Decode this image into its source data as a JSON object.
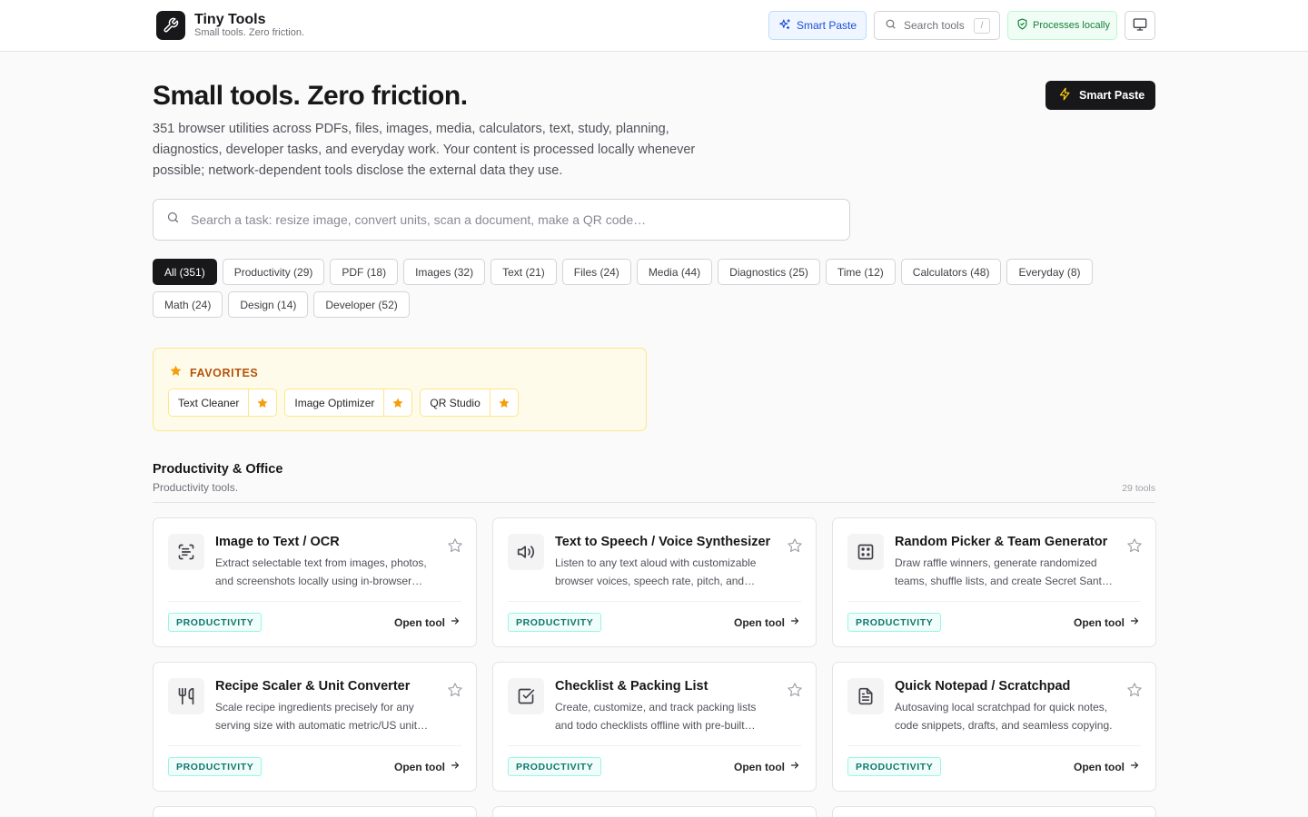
{
  "header": {
    "brand_title": "Tiny Tools",
    "brand_subtitle": "Small tools. Zero friction.",
    "smart_paste_label": "Smart Paste",
    "search_label": "Search tools",
    "search_shortcut": "/",
    "local_badge": "Processes locally"
  },
  "hero": {
    "title": "Small tools. Zero friction.",
    "description": "351 browser utilities across PDFs, files, images, media, calculators, text, study, planning, diagnostics, developer tasks, and everyday work. Your content is processed locally whenever possible; network-dependent tools disclose the external data they use.",
    "smart_paste_label": "Smart Paste",
    "search_placeholder": "Search a task: resize image, convert units, scan a document, make a QR code…"
  },
  "categories": [
    {
      "label": "All (351)",
      "active": true
    },
    {
      "label": "Productivity (29)"
    },
    {
      "label": "PDF (18)"
    },
    {
      "label": "Images (32)"
    },
    {
      "label": "Text (21)"
    },
    {
      "label": "Files (24)"
    },
    {
      "label": "Media (44)"
    },
    {
      "label": "Diagnostics (25)"
    },
    {
      "label": "Time (12)"
    },
    {
      "label": "Calculators (48)"
    },
    {
      "label": "Everyday (8)"
    },
    {
      "label": "Math (24)"
    },
    {
      "label": "Design (14)"
    },
    {
      "label": "Developer (52)"
    }
  ],
  "favorites": {
    "title": "FAVORITES",
    "items": [
      "Text Cleaner",
      "Image Optimizer",
      "QR Studio"
    ]
  },
  "section": {
    "title": "Productivity & Office",
    "subtitle": "Productivity tools.",
    "count": "29 tools"
  },
  "tools": [
    {
      "title": "Image to Text / OCR",
      "desc": "Extract selectable text from images, photos, and screenshots locally using in-browser OCR.",
      "badge": "PRODUCTIVITY",
      "open": "Open tool",
      "icon": "scan-text-icon"
    },
    {
      "title": "Text to Speech / Voice Synthesizer",
      "desc": "Listen to any text aloud with customizable browser voices, speech rate, pitch, and volume.",
      "badge": "PRODUCTIVITY",
      "open": "Open tool",
      "icon": "speaker-icon"
    },
    {
      "title": "Random Picker & Team Generator",
      "desc": "Draw raffle winners, generate randomized teams, shuffle lists, and create Secret Santa pairs.",
      "badge": "PRODUCTIVITY",
      "open": "Open tool",
      "icon": "dice-icon"
    },
    {
      "title": "Recipe Scaler & Unit Converter",
      "desc": "Scale recipe ingredients precisely for any serving size with automatic metric/US unit conversion.",
      "badge": "PRODUCTIVITY",
      "open": "Open tool",
      "icon": "utensils-icon"
    },
    {
      "title": "Checklist & Packing List",
      "desc": "Create, customize, and track packing lists and todo checklists offline with pre-built templates.",
      "badge": "PRODUCTIVITY",
      "open": "Open tool",
      "icon": "checkbox-icon"
    },
    {
      "title": "Quick Notepad / Scratchpad",
      "desc": "Autosaving local scratchpad for quick notes, code snippets, drafts, and seamless copying.",
      "badge": "PRODUCTIVITY",
      "open": "Open tool",
      "icon": "document-icon"
    }
  ],
  "colors": {
    "accent": "#18181b",
    "favorite_star": "#f59e0b",
    "badge_teal": "#0f766e",
    "local_green": "#15803d",
    "smart_paste_blue": "#1d4ed8"
  }
}
